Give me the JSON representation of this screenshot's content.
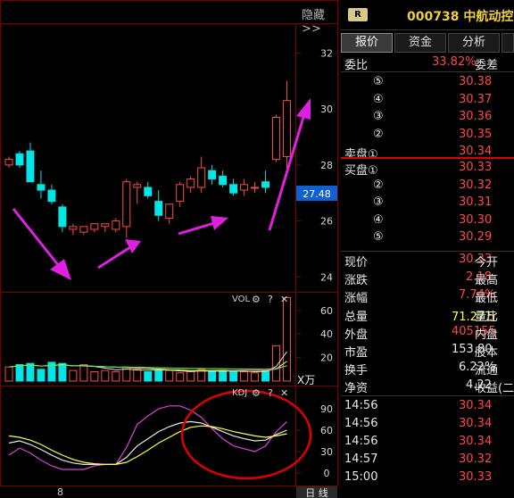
{
  "header": {
    "hide_label": "隐藏>>",
    "badge": "R",
    "stock_code": "000738",
    "stock_name": "中航动控"
  },
  "tabs": [
    {
      "label": "报价"
    },
    {
      "label": "资金"
    },
    {
      "label": "分析"
    }
  ],
  "colors": {
    "up": "#ff4848",
    "down": "#00e5e5",
    "accent_yellow": "#ffff40",
    "arrow": "#e020e0",
    "circle": "#e00000"
  },
  "weibi": {
    "label": "委比",
    "value": "33.82%",
    "label2": "委差"
  },
  "asks": [
    {
      "label": "⑤",
      "price": "30.38"
    },
    {
      "label": "④",
      "price": "30.37"
    },
    {
      "label": "③",
      "price": "30.36"
    },
    {
      "label": "②",
      "price": "30.35"
    },
    {
      "label": "卖盘①",
      "price": "30.34"
    }
  ],
  "bids": [
    {
      "label": "买盘①",
      "price": "30.33"
    },
    {
      "label": "②",
      "price": "30.32"
    },
    {
      "label": "③",
      "price": "30.31"
    },
    {
      "label": "④",
      "price": "30.30"
    },
    {
      "label": "⑤",
      "price": "30.29"
    }
  ],
  "quote": [
    {
      "l1": "现价",
      "v1": "30.33",
      "l2": "今开"
    },
    {
      "l1": "涨跌",
      "v1": "2.18",
      "l2": "最高"
    },
    {
      "l1": "涨幅",
      "v1": "7.74%",
      "l2": "最低"
    },
    {
      "l1": "总量",
      "v1": "71.27万",
      "l2": "量比"
    },
    {
      "l1": "外盘",
      "v1": "405155",
      "l2": "内盘"
    },
    {
      "l1": "市盈",
      "v1": "153.80",
      "l2": "股本"
    },
    {
      "l1": "换手",
      "v1": "6.22%",
      "l2": "流通"
    },
    {
      "l1": "净资",
      "v1": "4.22",
      "l2": "收益(二"
    }
  ],
  "ticks": [
    {
      "time": "14:56",
      "price": "30.34"
    },
    {
      "time": "14:56",
      "price": "30.34"
    },
    {
      "time": "14:56",
      "price": "30.34"
    },
    {
      "time": "14:57",
      "price": "30.32"
    },
    {
      "time": "15:00",
      "price": "30.33"
    }
  ],
  "chart_data": {
    "type": "candlestick",
    "price_axis": {
      "ticks": [
        "32",
        "30",
        "28",
        "26",
        "24"
      ],
      "range": [
        23.5,
        33
      ]
    },
    "current_price_label": "27.48",
    "candles": [
      {
        "o": 28.0,
        "h": 28.3,
        "l": 27.9,
        "c": 28.2
      },
      {
        "o": 28.4,
        "h": 28.5,
        "l": 27.9,
        "c": 28.0
      },
      {
        "o": 28.5,
        "h": 28.8,
        "l": 27.4,
        "c": 27.4
      },
      {
        "o": 27.3,
        "h": 27.8,
        "l": 26.8,
        "c": 27.1
      },
      {
        "o": 27.1,
        "h": 27.3,
        "l": 26.6,
        "c": 26.7
      },
      {
        "o": 26.5,
        "h": 26.6,
        "l": 25.6,
        "c": 25.8
      },
      {
        "o": 25.7,
        "h": 25.9,
        "l": 25.5,
        "c": 25.8
      },
      {
        "o": 25.6,
        "h": 25.8,
        "l": 25.5,
        "c": 25.8
      },
      {
        "o": 25.7,
        "h": 25.9,
        "l": 25.6,
        "c": 25.9
      },
      {
        "o": 25.8,
        "h": 25.9,
        "l": 25.6,
        "c": 25.9
      },
      {
        "o": 25.7,
        "h": 26.1,
        "l": 25.6,
        "c": 26.0
      },
      {
        "o": 25.8,
        "h": 27.5,
        "l": 25.4,
        "c": 27.4
      },
      {
        "o": 27.2,
        "h": 27.4,
        "l": 26.6,
        "c": 27.3
      },
      {
        "o": 27.2,
        "h": 27.4,
        "l": 26.8,
        "c": 26.9
      },
      {
        "o": 26.7,
        "h": 27.1,
        "l": 26.0,
        "c": 26.2
      },
      {
        "o": 26.1,
        "h": 26.6,
        "l": 25.9,
        "c": 26.6
      },
      {
        "o": 26.7,
        "h": 27.4,
        "l": 26.5,
        "c": 27.3
      },
      {
        "o": 27.2,
        "h": 27.6,
        "l": 27.0,
        "c": 27.5
      },
      {
        "o": 27.2,
        "h": 28.3,
        "l": 27.0,
        "c": 27.9
      },
      {
        "o": 27.8,
        "h": 28.0,
        "l": 27.3,
        "c": 27.5
      },
      {
        "o": 27.6,
        "h": 27.8,
        "l": 27.2,
        "c": 27.3
      },
      {
        "o": 27.3,
        "h": 27.5,
        "l": 26.9,
        "c": 27.0
      },
      {
        "o": 27.1,
        "h": 27.5,
        "l": 26.9,
        "c": 27.3
      },
      {
        "o": 27.2,
        "h": 27.4,
        "l": 27.0,
        "c": 27.2
      },
      {
        "o": 27.4,
        "h": 27.8,
        "l": 27.0,
        "c": 27.2
      },
      {
        "o": 28.2,
        "h": 29.8,
        "l": 28.1,
        "c": 29.7
      },
      {
        "o": 28.3,
        "h": 31.0,
        "l": 27.6,
        "c": 30.3
      }
    ],
    "volume": {
      "label": "VOL",
      "unit": "X万",
      "axis_ticks": [
        "60",
        "40",
        "20"
      ],
      "range": [
        0,
        72
      ],
      "values": [
        12,
        14,
        15,
        10,
        16,
        15,
        9,
        14,
        8,
        9,
        8,
        12,
        10,
        8,
        9,
        9,
        7,
        8,
        10,
        8,
        9,
        8,
        8,
        7,
        9,
        30,
        71
      ]
    },
    "kdj": {
      "label": "KDJ",
      "axis_ticks": [
        "90",
        "60",
        "30",
        "0"
      ],
      "range": [
        -10,
        105
      ],
      "k": [
        42,
        45,
        40,
        33,
        25,
        18,
        14,
        12,
        12,
        12,
        12,
        22,
        38,
        48,
        58,
        65,
        70,
        72,
        70,
        64,
        58,
        52,
        48,
        45,
        46,
        54,
        60
      ],
      "d": [
        52,
        50,
        46,
        40,
        32,
        25,
        19,
        15,
        13,
        12,
        12,
        15,
        23,
        32,
        42,
        50,
        58,
        64,
        66,
        65,
        62,
        58,
        55,
        52,
        50,
        52,
        55
      ],
      "j": [
        25,
        35,
        28,
        18,
        10,
        5,
        5,
        5,
        10,
        12,
        12,
        36,
        68,
        80,
        90,
        94,
        94,
        88,
        78,
        62,
        48,
        38,
        34,
        30,
        38,
        58,
        72
      ]
    },
    "x_label": "8",
    "period_label": "日 线"
  }
}
